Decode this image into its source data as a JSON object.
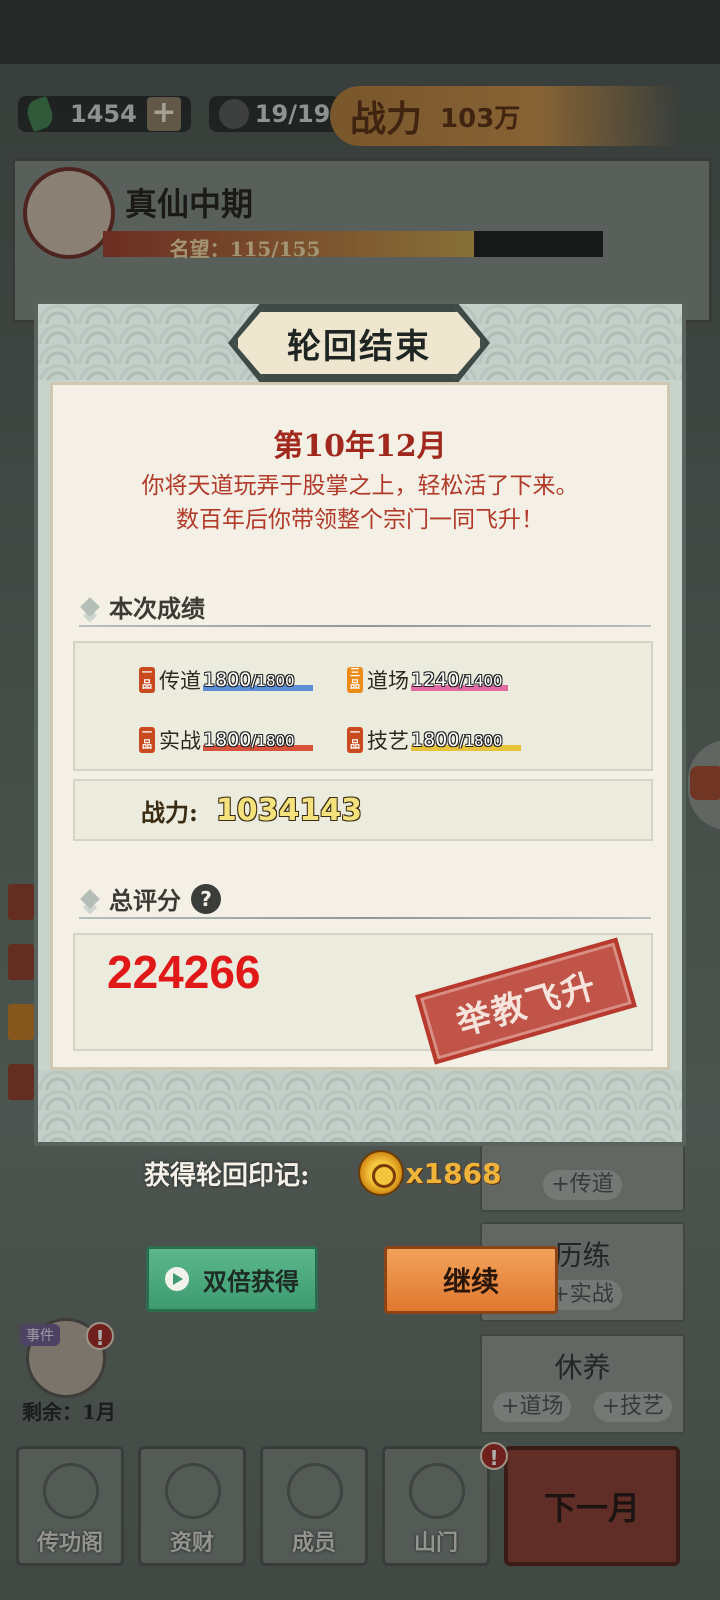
{
  "top_bar": {
    "jade_count": "1454",
    "plus_label": "+",
    "members": "19/19",
    "power_label": "战力",
    "power_value": "103万"
  },
  "profile": {
    "realm": "真仙中期",
    "fame_text": "名望：115/155",
    "fame_progress": 0.742
  },
  "nav": {
    "items": [
      {
        "label": "传功阁",
        "icon": "robe-icon"
      },
      {
        "label": "资财",
        "icon": "money-bag-icon"
      },
      {
        "label": "成员",
        "icon": "member-icon"
      },
      {
        "label": "山门",
        "icon": "mountain-gate-icon"
      }
    ],
    "next_month": "下一月"
  },
  "actions": [
    {
      "title": "",
      "subs": [
        "+传道"
      ]
    },
    {
      "title": "历练",
      "subs": [
        "+实战"
      ]
    },
    {
      "title": "休养",
      "subs": [
        "+道场",
        "+技艺"
      ]
    }
  ],
  "event": {
    "tag": "事件",
    "remaining": "剩余：1月",
    "alert": "!"
  },
  "modal": {
    "title": "轮回结束",
    "date": "第10年12月",
    "message_line1": "你将天道玩弄于股掌之上，轻松活了下来。",
    "message_line2": "数百年后你带领整个宗门一同飞升！",
    "section_results": "本次成绩",
    "stats": [
      {
        "grade": "一品",
        "name": "传道",
        "value": "1800",
        "max": "/1800",
        "progress": 1.0,
        "color": "#5c8ed8"
      },
      {
        "grade": "三品",
        "name": "道场",
        "value": "1240",
        "max": "/1400",
        "progress": 0.886,
        "color": "#e46aa4"
      },
      {
        "grade": "一品",
        "name": "实战",
        "value": "1800",
        "max": "/1800",
        "progress": 1.0,
        "color": "#d8533c"
      },
      {
        "grade": "一品",
        "name": "技艺",
        "value": "1800",
        "max": "/1800",
        "progress": 1.0,
        "color": "#e7c23a"
      }
    ],
    "power_label": "战力:",
    "power_value": "1034143",
    "section_score": "总评分",
    "help": "?",
    "total_score": "224266",
    "stamp": "举教飞升"
  },
  "reward": {
    "label": "获得轮回印记:",
    "amount": "x1868"
  },
  "buttons": {
    "double": "双倍获得",
    "continue": "继续"
  }
}
